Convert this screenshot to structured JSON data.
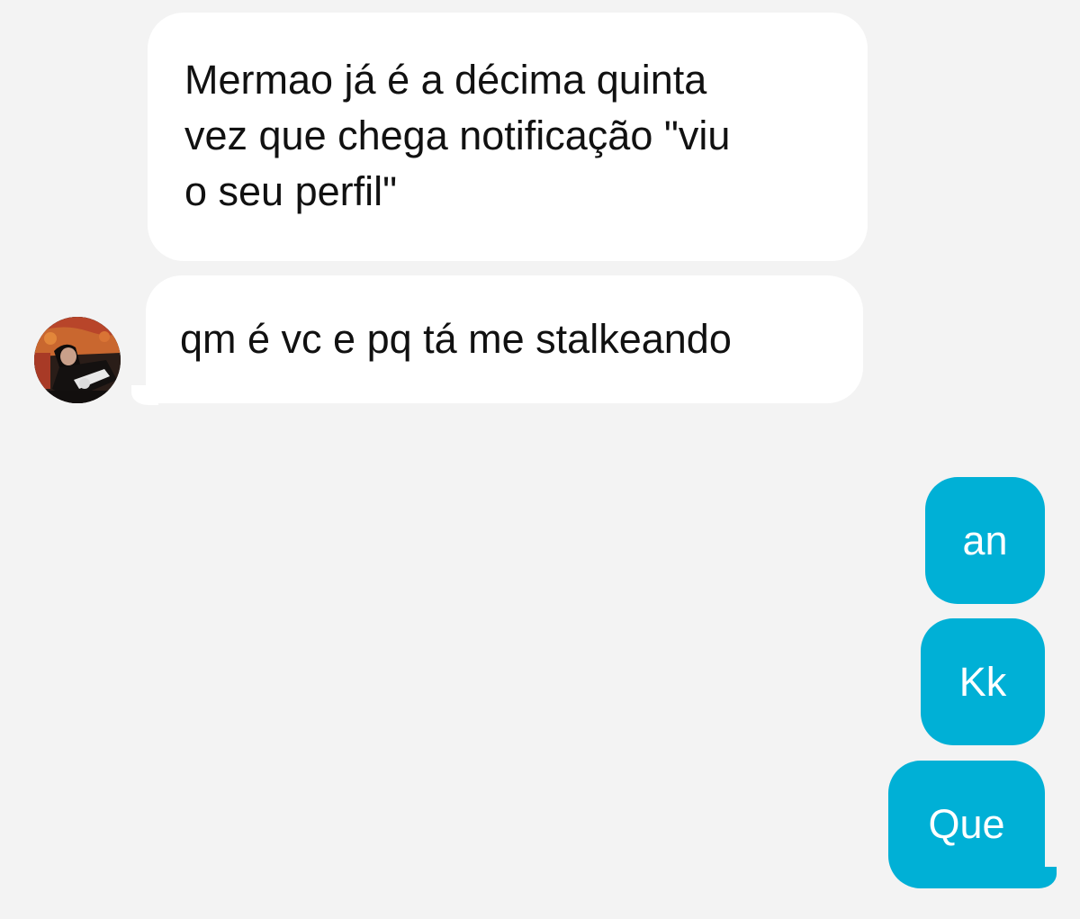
{
  "conversation": {
    "messages": [
      {
        "sender": "other",
        "text": "Mermao já é a décima quinta\nvez que chega notificação \"viu\no seu perfil\""
      },
      {
        "sender": "other",
        "text": "qm é vc e pq tá me stalkeando"
      },
      {
        "sender": "me",
        "text": "an"
      },
      {
        "sender": "me",
        "text": "Kk"
      },
      {
        "sender": "me",
        "text": "Que"
      }
    ]
  },
  "colors": {
    "background": "#f3f3f3",
    "incoming_bubble": "#ffffff",
    "outgoing_bubble": "#00b0d6",
    "incoming_text": "#111111",
    "outgoing_text": "#ffffff"
  }
}
